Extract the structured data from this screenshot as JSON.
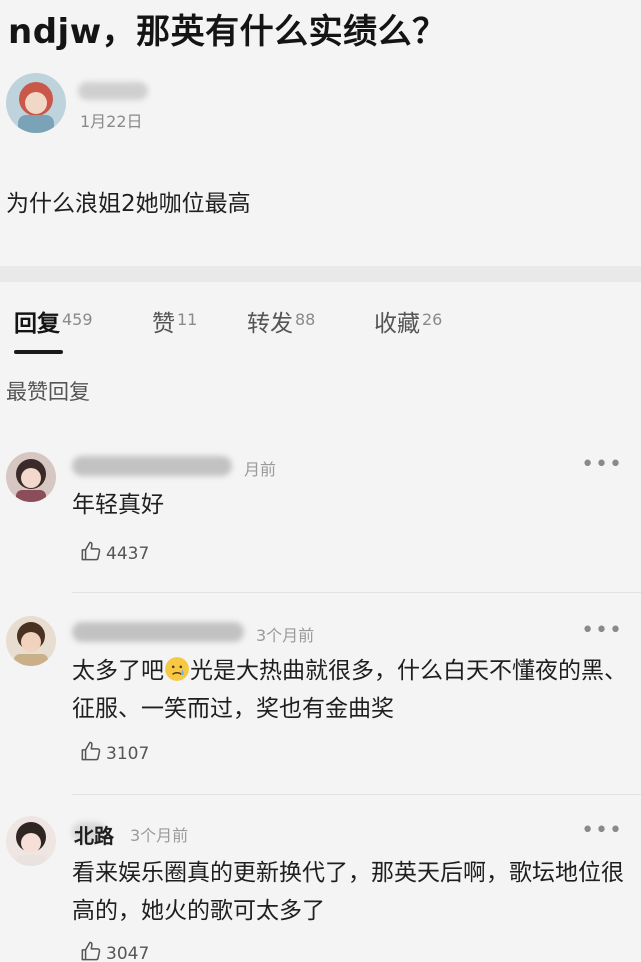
{
  "post": {
    "title": "ndjw，那英有什么实绩么？",
    "date": "1月22日",
    "body": "为什么浪姐2她咖位最高"
  },
  "tabs": [
    {
      "label": "回复",
      "count": "459"
    },
    {
      "label": "赞",
      "count": "11"
    },
    {
      "label": "转发",
      "count": "88"
    },
    {
      "label": "收藏",
      "count": "26"
    }
  ],
  "section_label": "最赞回复",
  "comments": [
    {
      "time": "月前",
      "text": "年轻真好",
      "likes": "4437"
    },
    {
      "time": "3个月前",
      "text_before": "太多了吧",
      "emoji": "worried-face",
      "text_after": "光是大热曲就很多，什么白天不懂夜的黑、征服、一笑而过，奖也有金曲奖",
      "likes": "3107"
    },
    {
      "name": "北路",
      "time": "3个月前",
      "text": "看来娱乐圈真的更新换代了，那英天后啊，歌坛地位很高的，她火的歌可太多了",
      "likes": "3047"
    }
  ],
  "more_glyph": "•••",
  "colors": {
    "background": "#f4f4f4",
    "text": "#1a1a1a",
    "muted": "#8a8a8a"
  }
}
